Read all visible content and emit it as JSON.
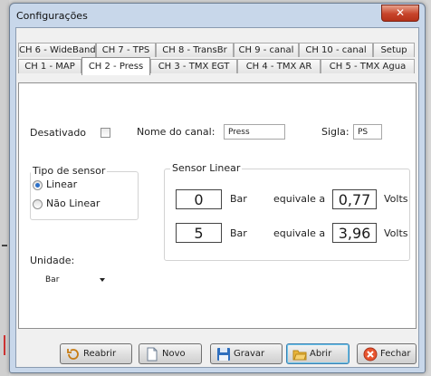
{
  "window": {
    "title": "Configurações",
    "close_glyph": "✕"
  },
  "tabs_row1": [
    {
      "label": "CH 6 - WideBand"
    },
    {
      "label": "CH 7 - TPS"
    },
    {
      "label": "CH 8 - TransBr"
    },
    {
      "label": "CH 9 - canal"
    },
    {
      "label": "CH 10 - canal"
    },
    {
      "label": "Setup"
    }
  ],
  "tabs_row2": [
    {
      "label": "CH 1 - MAP"
    },
    {
      "label": "CH 2 - Press",
      "active": true
    },
    {
      "label": "CH 3 - TMX EGT"
    },
    {
      "label": "CH 4 - TMX AR"
    },
    {
      "label": "CH 5 - TMX Agua"
    }
  ],
  "channel": {
    "disabled_label": "Desativado",
    "disabled_checked": false,
    "name_label": "Nome do canal:",
    "name_value": "Press",
    "short_label": "Sigla:",
    "short_value": "PS"
  },
  "sensor_type": {
    "title": "Tipo de sensor",
    "options": [
      {
        "label": "Linear",
        "selected": true
      },
      {
        "label": "Não Linear",
        "selected": false
      }
    ]
  },
  "linear_sensor": {
    "title": "Sensor Linear",
    "rows": [
      {
        "pressure": "0",
        "unit": "Bar",
        "equiv": "equivale a",
        "volts": "0,77",
        "vunit": "Volts"
      },
      {
        "pressure": "5",
        "unit": "Bar",
        "equiv": "equivale a",
        "volts": "3,96",
        "vunit": "Volts"
      }
    ]
  },
  "unit": {
    "label": "Unidade:",
    "value": "Bar"
  },
  "buttons": [
    {
      "label": "Reabrir",
      "icon": "reopen-icon"
    },
    {
      "label": "Novo",
      "icon": "new-document-icon"
    },
    {
      "label": "Gravar",
      "icon": "save-icon"
    },
    {
      "label": "Abrir",
      "icon": "open-folder-icon"
    },
    {
      "label": "Fechar",
      "icon": "close-circle-icon"
    }
  ],
  "colors": {
    "accent": "#2b70c9",
    "close_red": "#c7442a",
    "frame": "#c8d7ea"
  }
}
